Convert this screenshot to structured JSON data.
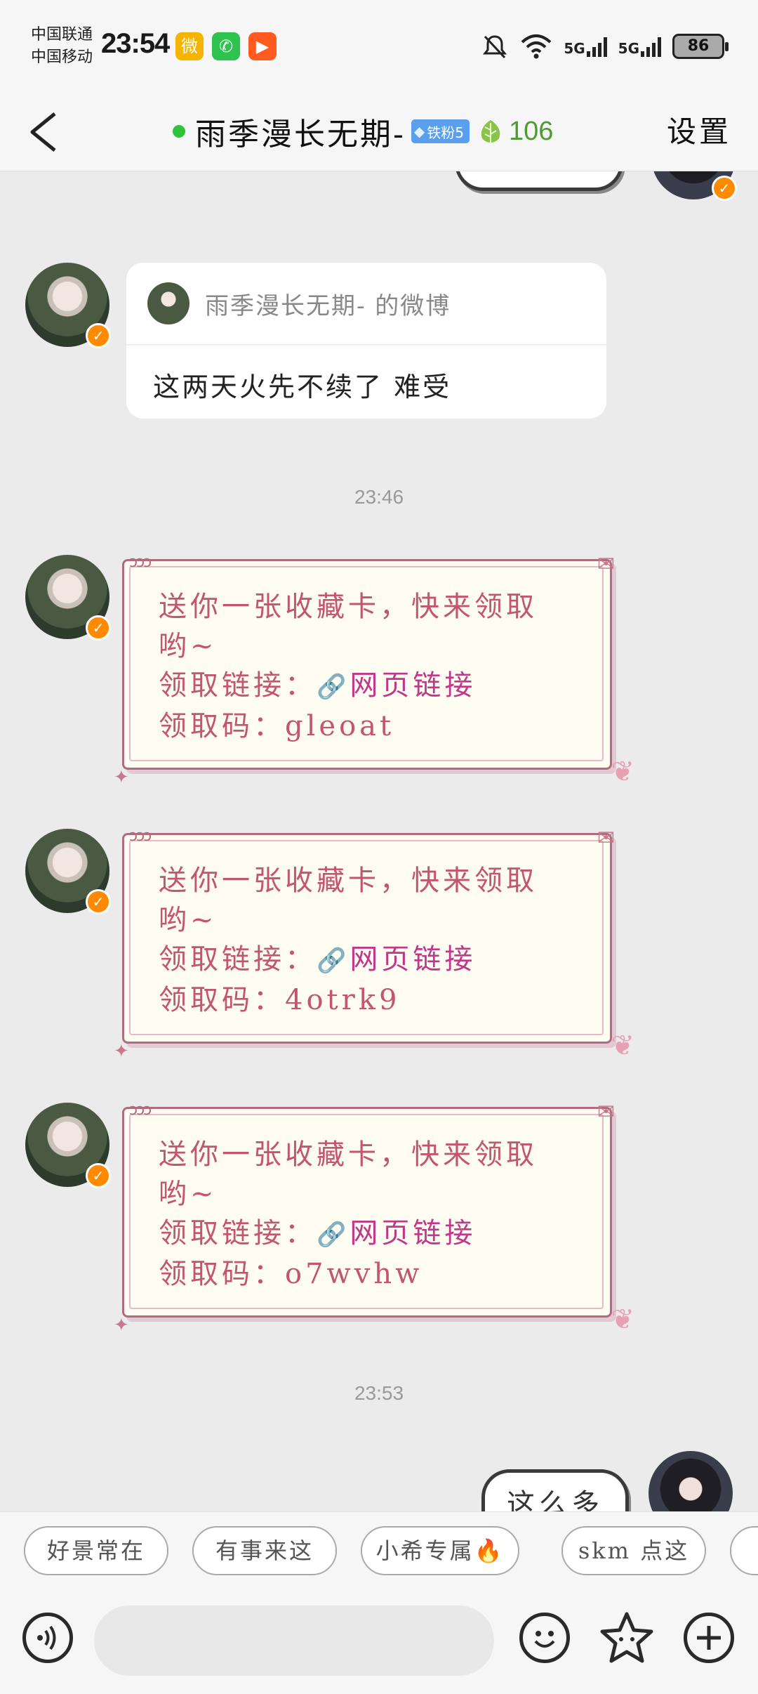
{
  "status": {
    "carrier1": "中国联通",
    "carrier2": "中国移动",
    "time": "23:54",
    "net1": "5G",
    "net2": "5G",
    "battery": "86"
  },
  "apps": {
    "weibo": "微",
    "wechat": "✆",
    "kuaishou": "▶"
  },
  "header": {
    "title": "雨季漫长无期-",
    "fan_badge": "铁粉5",
    "score": "106",
    "settings": "设置"
  },
  "messages": {
    "share": {
      "source": "雨季漫长无期- 的微博",
      "text": "这两天火先不续了 难受"
    },
    "time1": "23:46",
    "cards": [
      {
        "line1": "送你一张收藏卡，快来领取",
        "line2": "哟~",
        "link_label": "领取链接：",
        "link_text": "网页链接",
        "code_label": "领取码：",
        "code": "gleoat"
      },
      {
        "line1": "送你一张收藏卡，快来领取",
        "line2": "哟~",
        "link_label": "领取链接：",
        "link_text": "网页链接",
        "code_label": "领取码：",
        "code": "4otrk9"
      },
      {
        "line1": "送你一张收藏卡，快来领取",
        "line2": "哟~",
        "link_label": "领取链接：",
        "link_text": "网页链接",
        "code_label": "领取码：",
        "code": "o7wvhw"
      }
    ],
    "time2": "23:53",
    "my_last": "这么多"
  },
  "quick_replies": [
    "好景常在",
    "有事来这",
    "小希专属🔥",
    "skm 点这"
  ],
  "icons": {
    "back": "back-arrow-icon",
    "voice": "voice-icon",
    "emoji": "emoji-icon",
    "sticker": "star-sticker-icon",
    "plus": "plus-icon"
  },
  "colors": {
    "card_text": "#c2566e",
    "link": "#c0388a",
    "online": "#2fc33c",
    "score": "#4e9a35"
  }
}
